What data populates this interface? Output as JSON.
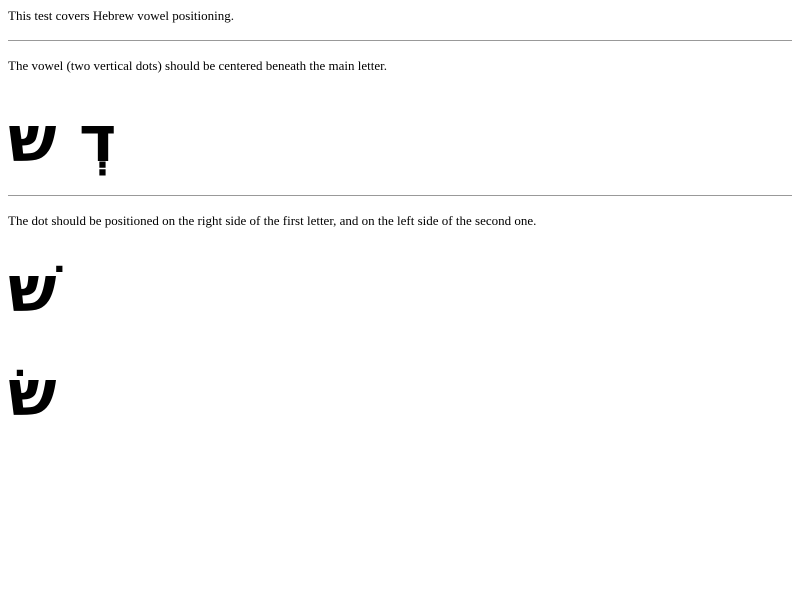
{
  "intro": "This test covers Hebrew vowel positioning.",
  "section1": {
    "instruction": "The vowel (two vertical dots) should be centered beneath the main letter.",
    "sample": "דְ ש"
  },
  "section2": {
    "instruction": "The dot should be positioned on the right side of the first letter, and on the left side of the second one.",
    "sample_shin": "שׁ",
    "sample_sin": "שׂ"
  }
}
